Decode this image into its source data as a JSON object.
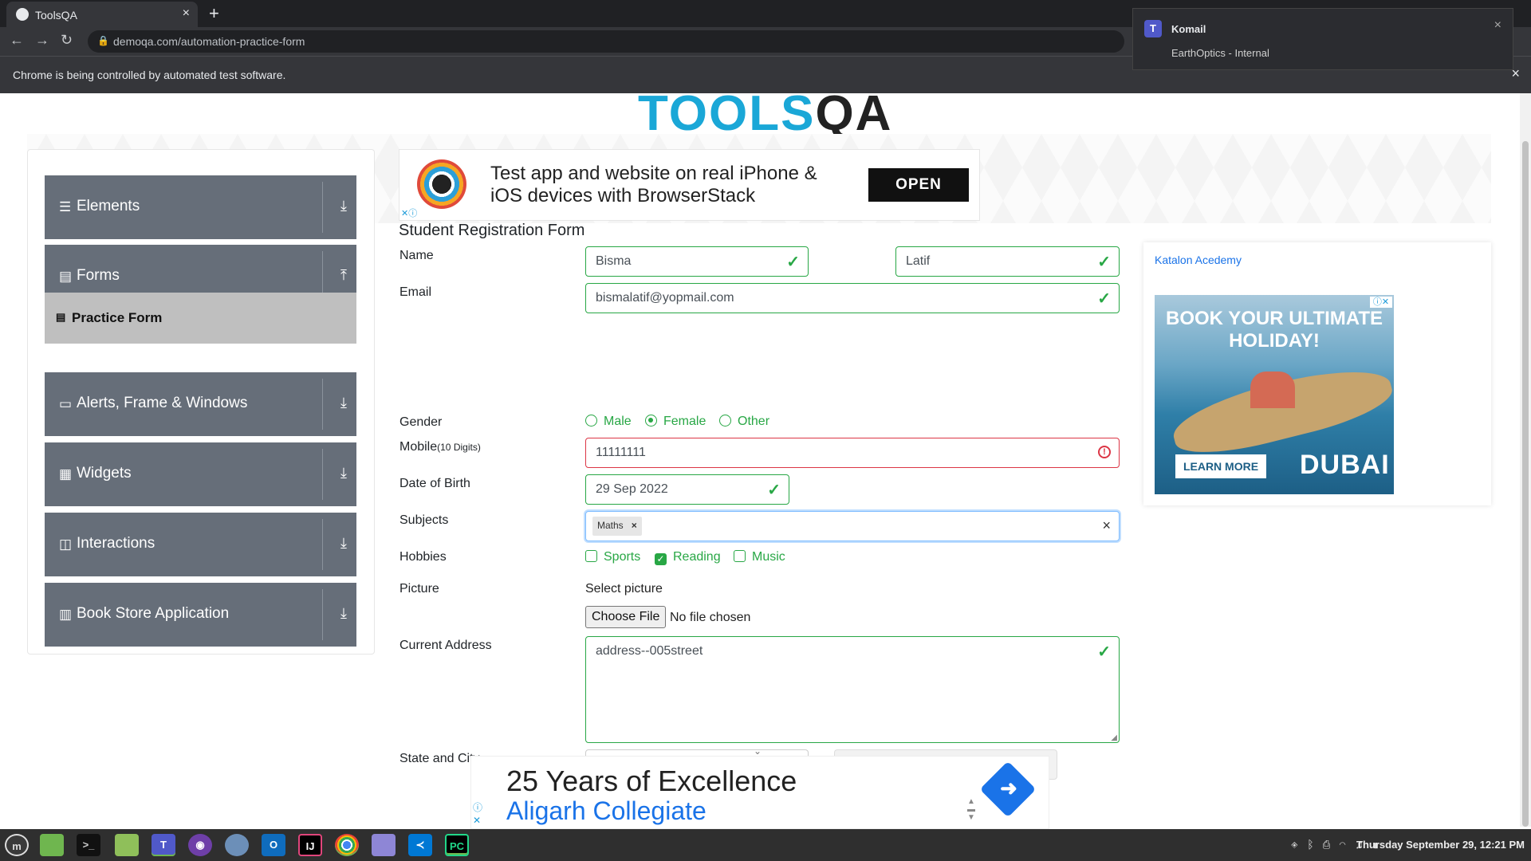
{
  "browser": {
    "tab_title": "ToolsQA",
    "tab_close": "×",
    "new_tab": "+",
    "url": "demoqa.com/automation-practice-form",
    "infobar_message": "Chrome is being controlled by automated test software.",
    "infobar_close": "×"
  },
  "notification": {
    "sender": "Komail",
    "body": "EarthOptics - Internal",
    "close": "×"
  },
  "page": {
    "title": "Practice Form",
    "logo_fragment": "TOOLS",
    "logo_fragment_qa": "QA"
  },
  "sidebar": {
    "groups": [
      {
        "label": "Elements",
        "icon": "☰",
        "arrow": "⤓"
      },
      {
        "label": "Forms",
        "icon": "▤",
        "arrow": "⤒"
      },
      {
        "label": "Alerts, Frame & Windows",
        "icon": "▭",
        "arrow": "⤓"
      },
      {
        "label": "Widgets",
        "icon": "▦",
        "arrow": "⤓"
      },
      {
        "label": "Interactions",
        "icon": "◫",
        "arrow": "⤓"
      },
      {
        "label": "Book Store Application",
        "icon": "▥",
        "arrow": "⤓"
      }
    ],
    "active_item": {
      "label": "Practice Form",
      "icon": "▤"
    }
  },
  "ad_top": {
    "text": "Test app and website on real iPhone & iOS devices with BrowserStack",
    "button": "OPEN"
  },
  "form": {
    "title": "Student Registration Form",
    "labels": {
      "name": "Name",
      "email": "Email",
      "gender": "Gender",
      "mobile": "Mobile",
      "mobile_hint": "(10 Digits)",
      "dob": "Date of Birth",
      "subjects": "Subjects",
      "hobbies": "Hobbies",
      "picture": "Picture",
      "address": "Current Address",
      "state_city": "State and City"
    },
    "first_name": "Bisma",
    "last_name": "Latif",
    "email": "bismalatif@yopmail.com",
    "gender_options": [
      "Male",
      "Female",
      "Other"
    ],
    "gender_selected": "Female",
    "mobile": "11111111",
    "dob": "29 Sep 2022",
    "subject_chip": "Maths",
    "hobby_options": [
      "Sports",
      "Reading",
      "Music"
    ],
    "hobbies_checked": [
      "Reading"
    ],
    "select_picture": "Select picture",
    "choose_file": "Choose File",
    "no_file": "No file chosen",
    "address": "address--005street"
  },
  "ad_right": {
    "alt_text": "Katalon Acedemy",
    "headline": "BOOK YOUR ULTIMATE HOLIDAY!",
    "cta": "LEARN MORE",
    "brand": "DUBAI"
  },
  "ad_bottom": {
    "line1": "25 Years of Excellence",
    "line2": "Aligarh Collegiate"
  },
  "taskbar": {
    "clock": "Thursday September 29, 12:21 PM",
    "apps": [
      "menu",
      "files",
      "terminal",
      "folder",
      "teams",
      "github",
      "chromium",
      "outlook",
      "intellij",
      "chrome",
      "notes",
      "vscode",
      "pycharm"
    ]
  },
  "colors": {
    "valid": "#28a745",
    "invalid": "#dc3545",
    "sidebar_bg": "#666e79",
    "active_item_bg": "#bfbfbf"
  }
}
